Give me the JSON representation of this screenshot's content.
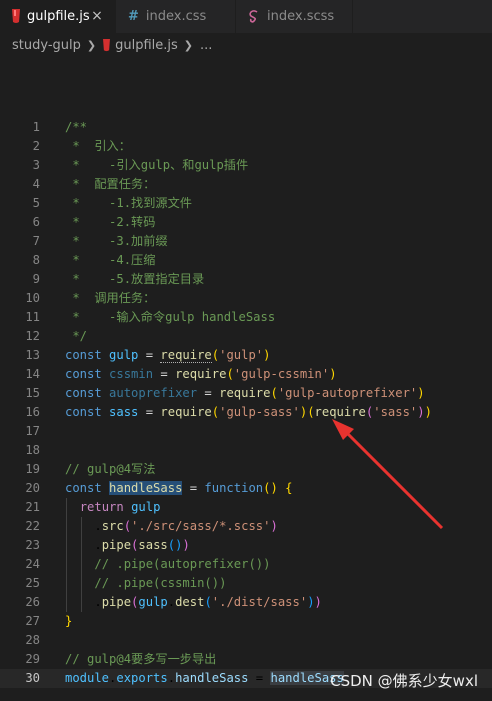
{
  "tabs": [
    {
      "label": "gulpfile.js",
      "icon": "gulp-icon",
      "active": true,
      "close": "×"
    },
    {
      "label": "index.css",
      "icon": "hash-icon",
      "active": false
    },
    {
      "label": "index.scss",
      "icon": "sass-icon",
      "active": false
    }
  ],
  "breadcrumb": {
    "folder": "study-gulp",
    "file": "gulpfile.js",
    "more": "..."
  },
  "editor": {
    "current_line": 30,
    "lines": [
      {
        "n": "1",
        "tokens": [
          {
            "t": "/**",
            "c": "t-comment"
          }
        ]
      },
      {
        "n": "2",
        "tokens": [
          {
            "t": " *  引入：",
            "c": "t-comment"
          }
        ]
      },
      {
        "n": "3",
        "tokens": [
          {
            "t": " *    -引入gulp、和gulp插件",
            "c": "t-comment"
          }
        ]
      },
      {
        "n": "4",
        "tokens": [
          {
            "t": " *  配置任务：",
            "c": "t-comment"
          }
        ]
      },
      {
        "n": "5",
        "tokens": [
          {
            "t": " *    -1.找到源文件",
            "c": "t-comment"
          }
        ]
      },
      {
        "n": "6",
        "tokens": [
          {
            "t": " *    -2.转码",
            "c": "t-comment"
          }
        ]
      },
      {
        "n": "7",
        "tokens": [
          {
            "t": " *    -3.加前缀",
            "c": "t-comment"
          }
        ]
      },
      {
        "n": "8",
        "tokens": [
          {
            "t": " *    -4.压缩",
            "c": "t-comment"
          }
        ]
      },
      {
        "n": "9",
        "tokens": [
          {
            "t": " *    -5.放置指定目录",
            "c": "t-comment"
          }
        ]
      },
      {
        "n": "10",
        "tokens": [
          {
            "t": " *  调用任务：",
            "c": "t-comment"
          }
        ]
      },
      {
        "n": "11",
        "tokens": [
          {
            "t": " *    -输入命令gulp handleSass",
            "c": "t-comment"
          }
        ]
      },
      {
        "n": "12",
        "tokens": [
          {
            "t": " */",
            "c": "t-comment"
          }
        ]
      },
      {
        "n": "13",
        "tokens": [
          {
            "t": "const ",
            "c": "t-kw"
          },
          {
            "t": "gulp",
            "c": "t-var"
          },
          {
            "t": " = ",
            "c": "t-op"
          },
          {
            "t": "require",
            "c": "t-fn uline"
          },
          {
            "t": "(",
            "c": "t-p1"
          },
          {
            "t": "'gulp'",
            "c": "t-str"
          },
          {
            "t": ")",
            "c": "t-p1"
          }
        ]
      },
      {
        "n": "14",
        "tokens": [
          {
            "t": "const ",
            "c": "t-kw"
          },
          {
            "t": "cssmin",
            "c": "t-var t-dim"
          },
          {
            "t": " = ",
            "c": "t-op"
          },
          {
            "t": "require",
            "c": "t-fn"
          },
          {
            "t": "(",
            "c": "t-p1"
          },
          {
            "t": "'",
            "c": "t-str"
          },
          {
            "t": "gulp-cssmin'",
            "c": "t-str"
          },
          {
            "t": ")",
            "c": "t-p1"
          }
        ]
      },
      {
        "n": "15",
        "tokens": [
          {
            "t": "const ",
            "c": "t-kw"
          },
          {
            "t": "autoprefixer",
            "c": "t-var t-dim"
          },
          {
            "t": " = ",
            "c": "t-op"
          },
          {
            "t": "require",
            "c": "t-fn"
          },
          {
            "t": "(",
            "c": "t-p1"
          },
          {
            "t": "'gulp-autoprefixer'",
            "c": "t-str"
          },
          {
            "t": ")",
            "c": "t-p1"
          }
        ]
      },
      {
        "n": "16",
        "tokens": [
          {
            "t": "const ",
            "c": "t-kw"
          },
          {
            "t": "sass",
            "c": "t-var"
          },
          {
            "t": " = ",
            "c": "t-op"
          },
          {
            "t": "require",
            "c": "t-fn"
          },
          {
            "t": "(",
            "c": "t-p1"
          },
          {
            "t": "'gulp-sass'",
            "c": "t-str"
          },
          {
            "t": ")",
            "c": "t-p1"
          },
          {
            "t": "(",
            "c": "t-p1"
          },
          {
            "t": "require",
            "c": "t-fn"
          },
          {
            "t": "(",
            "c": "t-p2"
          },
          {
            "t": "'sass'",
            "c": "t-str"
          },
          {
            "t": ")",
            "c": "t-p2"
          },
          {
            "t": ")",
            "c": "t-p1"
          }
        ]
      },
      {
        "n": "17",
        "tokens": []
      },
      {
        "n": "18",
        "tokens": []
      },
      {
        "n": "19",
        "tokens": [
          {
            "t": "// gulp@4写法",
            "c": "t-comment"
          }
        ]
      },
      {
        "n": "20",
        "tokens": [
          {
            "t": "const ",
            "c": "t-kw"
          },
          {
            "t": "handleSass",
            "c": "t-fn hl"
          },
          {
            "t": " = ",
            "c": "t-op"
          },
          {
            "t": "function",
            "c": "t-kw"
          },
          {
            "t": "() {",
            "c": "t-p1"
          }
        ]
      },
      {
        "n": "21",
        "guides": 1,
        "tokens": [
          {
            "t": "  "
          },
          {
            "t": "return ",
            "c": "t-ctl"
          },
          {
            "t": "gulp",
            "c": "t-var"
          }
        ]
      },
      {
        "n": "22",
        "guides": 2,
        "tokens": [
          {
            "t": "    ."
          },
          {
            "t": "src",
            "c": "t-fn"
          },
          {
            "t": "(",
            "c": "t-p2"
          },
          {
            "t": "'./src/sass/*.scss'",
            "c": "t-str"
          },
          {
            "t": ")",
            "c": "t-p2"
          }
        ]
      },
      {
        "n": "23",
        "guides": 2,
        "tokens": [
          {
            "t": "    ."
          },
          {
            "t": "pipe",
            "c": "t-fn"
          },
          {
            "t": "(",
            "c": "t-p2"
          },
          {
            "t": "sass",
            "c": "t-fn"
          },
          {
            "t": "()",
            "c": "t-p3"
          },
          {
            "t": ")",
            "c": "t-p2"
          }
        ]
      },
      {
        "n": "24",
        "guides": 2,
        "tokens": [
          {
            "t": "    "
          },
          {
            "t": "// .pipe(autoprefixer())",
            "c": "t-comment"
          }
        ]
      },
      {
        "n": "25",
        "guides": 2,
        "tokens": [
          {
            "t": "    "
          },
          {
            "t": "// .pipe(cssmin())",
            "c": "t-comment"
          }
        ]
      },
      {
        "n": "26",
        "guides": 2,
        "tokens": [
          {
            "t": "    ."
          },
          {
            "t": "pipe",
            "c": "t-fn"
          },
          {
            "t": "(",
            "c": "t-p2"
          },
          {
            "t": "gulp",
            "c": "t-var"
          },
          {
            "t": "."
          },
          {
            "t": "dest",
            "c": "t-fn"
          },
          {
            "t": "(",
            "c": "t-p3"
          },
          {
            "t": "'./dist/sass'",
            "c": "t-str"
          },
          {
            "t": ")",
            "c": "t-p3"
          },
          {
            "t": ")",
            "c": "t-p2"
          }
        ]
      },
      {
        "n": "27",
        "tokens": [
          {
            "t": "}",
            "c": "t-p1"
          }
        ]
      },
      {
        "n": "28",
        "tokens": []
      },
      {
        "n": "29",
        "tokens": [
          {
            "t": "// gulp@4要多写一步导出",
            "c": "t-comment"
          }
        ]
      },
      {
        "n": "30",
        "tokens": [
          {
            "t": "module",
            "c": "t-var"
          },
          {
            "t": "."
          },
          {
            "t": "exports",
            "c": "t-var"
          },
          {
            "t": "."
          },
          {
            "t": "handleSass",
            "c": "t-id"
          },
          {
            "t": " = "
          },
          {
            "t": "handleSass",
            "c": "t-id sel"
          }
        ]
      }
    ]
  },
  "annotation": {
    "color": "#e8332f"
  },
  "watermark": "CSDN @佛系少女wxl"
}
